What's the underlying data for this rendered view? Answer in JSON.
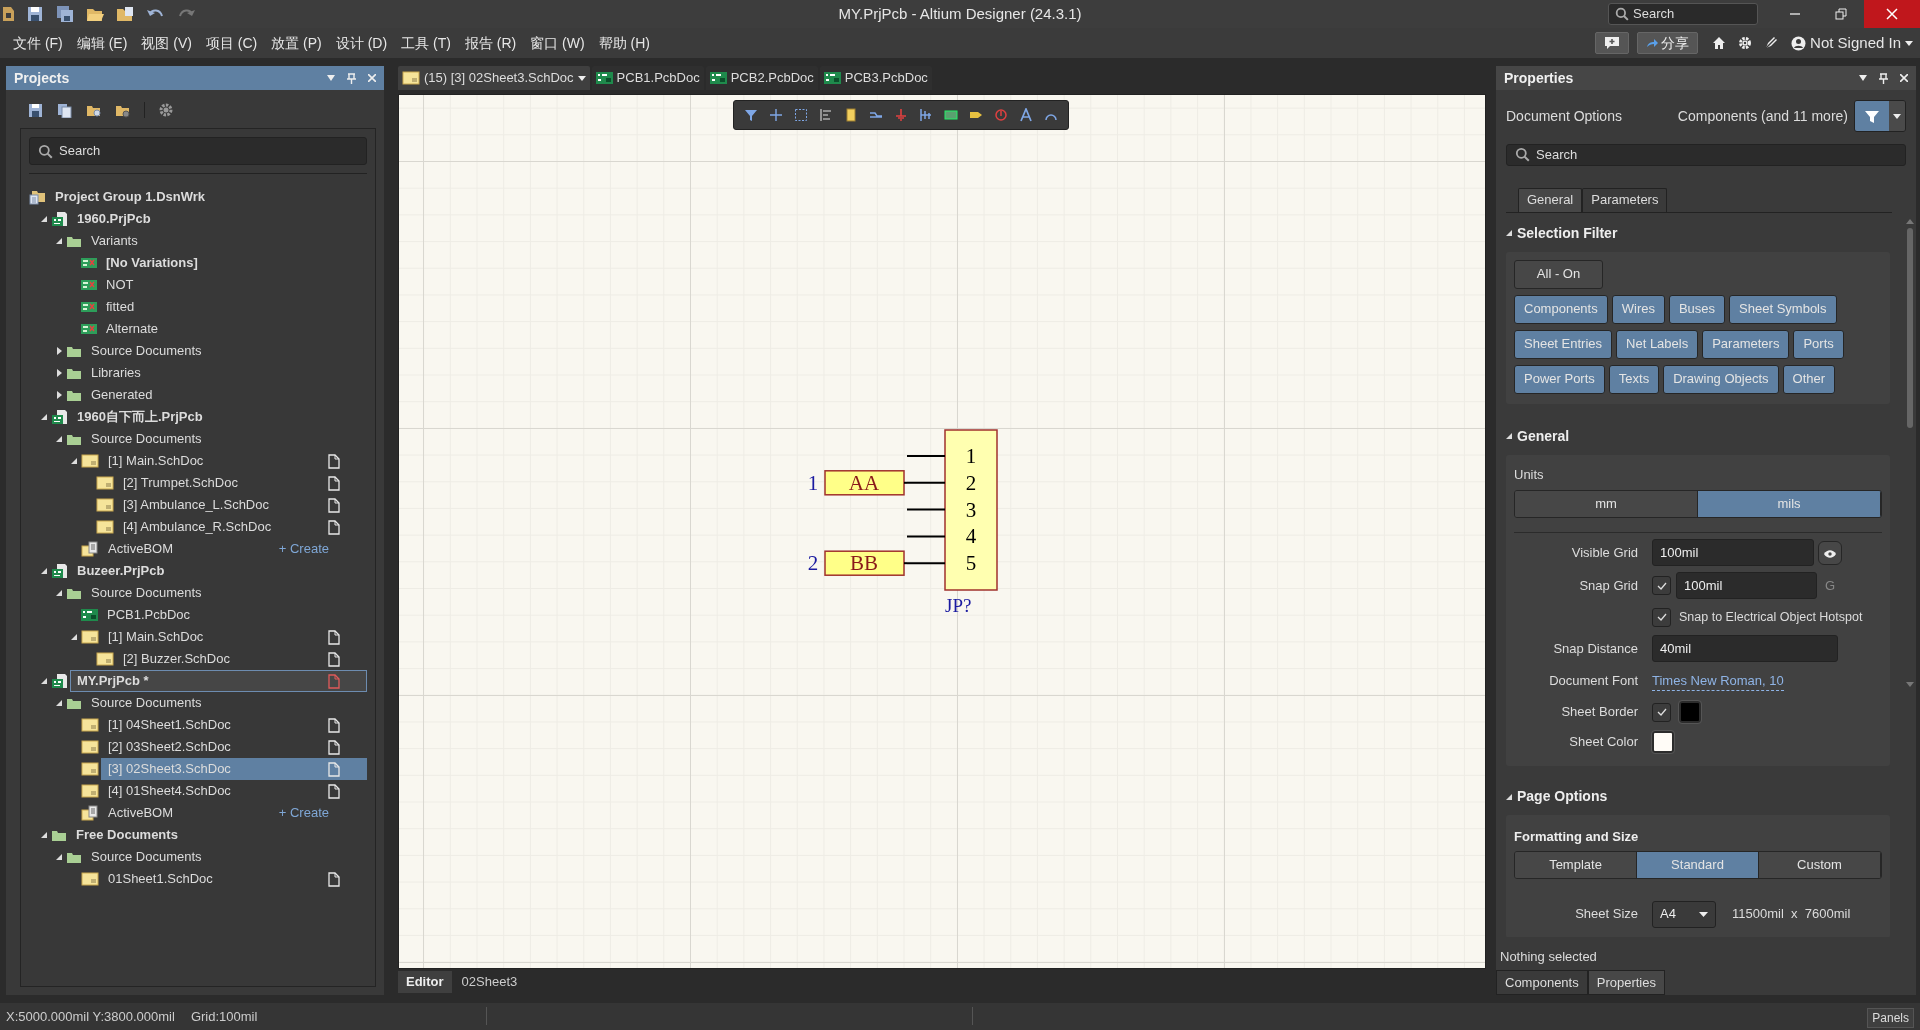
{
  "window": {
    "title": "MY.PrjPcb - Altium Designer (24.3.1)",
    "search_placeholder": "Search"
  },
  "menu": [
    "文件 (F)",
    "编辑 (E)",
    "视图 (V)",
    "项目 (C)",
    "放置 (P)",
    "设计 (D)",
    "工具 (T)",
    "报告 (R)",
    "窗口 (W)",
    "帮助 (H)"
  ],
  "account": {
    "share": "分享",
    "user": "Not Signed In"
  },
  "projects_panel": {
    "title": "Projects",
    "search_placeholder": "Search",
    "tree": [
      {
        "label": "Project Group 1.DsnWrk",
        "kind": "group",
        "selected": false,
        "children": [
          {
            "label": "1960.PrjPcb",
            "kind": "project",
            "expanded": true,
            "active": false,
            "selected": false,
            "children": [
              {
                "label": "Variants",
                "kind": "folder",
                "expanded": true,
                "selected": false,
                "children": [
                  {
                    "label": "[No Variations]",
                    "kind": "variant",
                    "current": true,
                    "selected": false
                  },
                  {
                    "label": "NOT",
                    "kind": "variant",
                    "current": false,
                    "selected": false
                  },
                  {
                    "label": "fitted",
                    "kind": "variant",
                    "current": false,
                    "selected": false
                  },
                  {
                    "label": "Alternate",
                    "kind": "variant",
                    "current": false,
                    "selected": false
                  }
                ]
              },
              {
                "label": "Source Documents",
                "kind": "folder",
                "expanded": false,
                "selected": false
              },
              {
                "label": "Libraries",
                "kind": "folder",
                "expanded": false,
                "selected": false
              },
              {
                "label": "Generated",
                "kind": "folder",
                "expanded": false,
                "selected": false
              }
            ]
          },
          {
            "label": "1960自下而上.PrjPcb",
            "kind": "project",
            "expanded": true,
            "active": false,
            "selected": false,
            "children": [
              {
                "label": "Source Documents",
                "kind": "folder",
                "expanded": true,
                "selected": false,
                "children": [
                  {
                    "label": "[1] Main.SchDoc",
                    "kind": "sch",
                    "expanded": true,
                    "selected": false,
                    "children": [
                      {
                        "label": "[2] Trumpet.SchDoc",
                        "kind": "sch",
                        "selected": false
                      },
                      {
                        "label": "[3] Ambulance_L.SchDoc",
                        "kind": "sch",
                        "selected": false
                      },
                      {
                        "label": "[4] Ambulance_R.SchDoc",
                        "kind": "sch",
                        "selected": false
                      }
                    ]
                  },
                  {
                    "label": "ActiveBOM",
                    "kind": "bom",
                    "action": "+ Create",
                    "selected": false
                  }
                ]
              }
            ]
          },
          {
            "label": "Buzeer.PrjPcb",
            "kind": "project",
            "expanded": true,
            "active": false,
            "selected": false,
            "children": [
              {
                "label": "Source Documents",
                "kind": "folder",
                "expanded": true,
                "selected": false,
                "children": [
                  {
                    "label": "PCB1.PcbDoc",
                    "kind": "pcb",
                    "selected": false
                  },
                  {
                    "label": "[1] Main.SchDoc",
                    "kind": "sch",
                    "expanded": true,
                    "selected": false,
                    "children": [
                      {
                        "label": "[2] Buzzer.SchDoc",
                        "kind": "sch",
                        "selected": false
                      }
                    ]
                  }
                ]
              }
            ]
          },
          {
            "label": "MY.PrjPcb *",
            "kind": "project",
            "expanded": true,
            "active": true,
            "selected": false,
            "children": [
              {
                "label": "Source Documents",
                "kind": "folder",
                "expanded": true,
                "selected": false,
                "children": [
                  {
                    "label": "[1] 04Sheet1.SchDoc",
                    "kind": "sch",
                    "selected": false
                  },
                  {
                    "label": "[2] 03Sheet2.SchDoc",
                    "kind": "sch",
                    "selected": false
                  },
                  {
                    "label": "[3] 02Sheet3.SchDoc",
                    "kind": "sch",
                    "selected": true
                  },
                  {
                    "label": "[4] 01Sheet4.SchDoc",
                    "kind": "sch",
                    "selected": false
                  },
                  {
                    "label": "ActiveBOM",
                    "kind": "bom",
                    "action": "+ Create",
                    "selected": false
                  }
                ]
              }
            ]
          },
          {
            "label": "Free Documents",
            "kind": "free",
            "expanded": true,
            "selected": false,
            "children": [
              {
                "label": "Source Documents",
                "kind": "folder",
                "expanded": true,
                "selected": false,
                "children": [
                  {
                    "label": "01Sheet1.SchDoc",
                    "kind": "sch",
                    "selected": false
                  }
                ]
              }
            ]
          }
        ]
      }
    ]
  },
  "document_tabs": [
    {
      "label": "(15) [3] 02Sheet3.SchDoc",
      "kind": "sch",
      "selected": true
    },
    {
      "label": "PCB1.PcbDoc",
      "kind": "pcb",
      "selected": false
    },
    {
      "label": "PCB2.PcbDoc",
      "kind": "pcb",
      "selected": false
    },
    {
      "label": "PCB3.PcbDoc",
      "kind": "pcb",
      "selected": false
    }
  ],
  "schematic": {
    "designator": "JP?",
    "pins": [
      {
        "number": "1"
      },
      {
        "number": "2",
        "port": {
          "label": "AA",
          "net": "1"
        }
      },
      {
        "number": "3"
      },
      {
        "number": "4"
      },
      {
        "number": "5",
        "port": {
          "label": "BB",
          "net": "2"
        }
      }
    ]
  },
  "editor_tabs": [
    {
      "label": "Editor",
      "selected": true
    },
    {
      "label": "02Sheet3",
      "selected": false
    }
  ],
  "properties": {
    "title": "Properties",
    "context": "Document Options",
    "filter_summary": "Components (and 11 more)",
    "search_placeholder": "Search",
    "tabs": [
      {
        "label": "General",
        "selected": true
      },
      {
        "label": "Parameters",
        "selected": false
      }
    ],
    "selection_filter": {
      "title": "Selection Filter",
      "all_button": "All - On",
      "filters": [
        [
          {
            "label": "Components",
            "on": true
          },
          {
            "label": "Wires",
            "on": true
          },
          {
            "label": "Buses",
            "on": true
          },
          {
            "label": "Sheet Symbols",
            "on": true
          }
        ],
        [
          {
            "label": "Sheet Entries",
            "on": true
          },
          {
            "label": "Net Labels",
            "on": true
          },
          {
            "label": "Parameters",
            "on": true
          },
          {
            "label": "Ports",
            "on": true
          }
        ],
        [
          {
            "label": "Power Ports",
            "on": true
          },
          {
            "label": "Texts",
            "on": true
          },
          {
            "label": "Drawing Objects",
            "on": true
          },
          {
            "label": "Other",
            "on": true
          }
        ]
      ]
    },
    "general": {
      "title": "General",
      "units_label": "Units",
      "units": [
        {
          "label": "mm",
          "selected": false
        },
        {
          "label": "mils",
          "selected": true
        }
      ],
      "rows": [
        {
          "kind": "input_eye",
          "label": "Visible Grid",
          "value": "100mil"
        },
        {
          "kind": "check_input",
          "label": "Snap Grid",
          "checked": true,
          "value": "100mil",
          "hint": "G"
        },
        {
          "kind": "check",
          "text": "Snap to Electrical Object Hotspot",
          "checked": true
        },
        {
          "kind": "input",
          "label": "Snap Distance",
          "value": "40mil"
        },
        {
          "kind": "link",
          "label": "Document Font",
          "value": "Times New Roman, 10"
        },
        {
          "kind": "check_color",
          "label": "Sheet Border",
          "checked": true,
          "color": "#000000"
        },
        {
          "kind": "color",
          "label": "Sheet Color",
          "color": "#fffcf7"
        }
      ]
    },
    "page_options": {
      "title": "Page Options",
      "subtitle": "Formatting and Size",
      "modes": [
        {
          "label": "Template",
          "selected": false
        },
        {
          "label": "Standard",
          "selected": true
        },
        {
          "label": "Custom",
          "selected": false
        }
      ],
      "sheet_size_label": "Sheet Size",
      "sheet_size": "A4",
      "dimensions": "11500mil  x  7600mil"
    },
    "status": "Nothing selected",
    "bottom_tabs": [
      {
        "label": "Components",
        "selected": false
      },
      {
        "label": "Properties",
        "selected": true
      }
    ]
  },
  "status_bar": {
    "position": "X:5000.000mil Y:3800.000mil",
    "grid": "Grid:100mil",
    "panels_button": "Panels"
  }
}
